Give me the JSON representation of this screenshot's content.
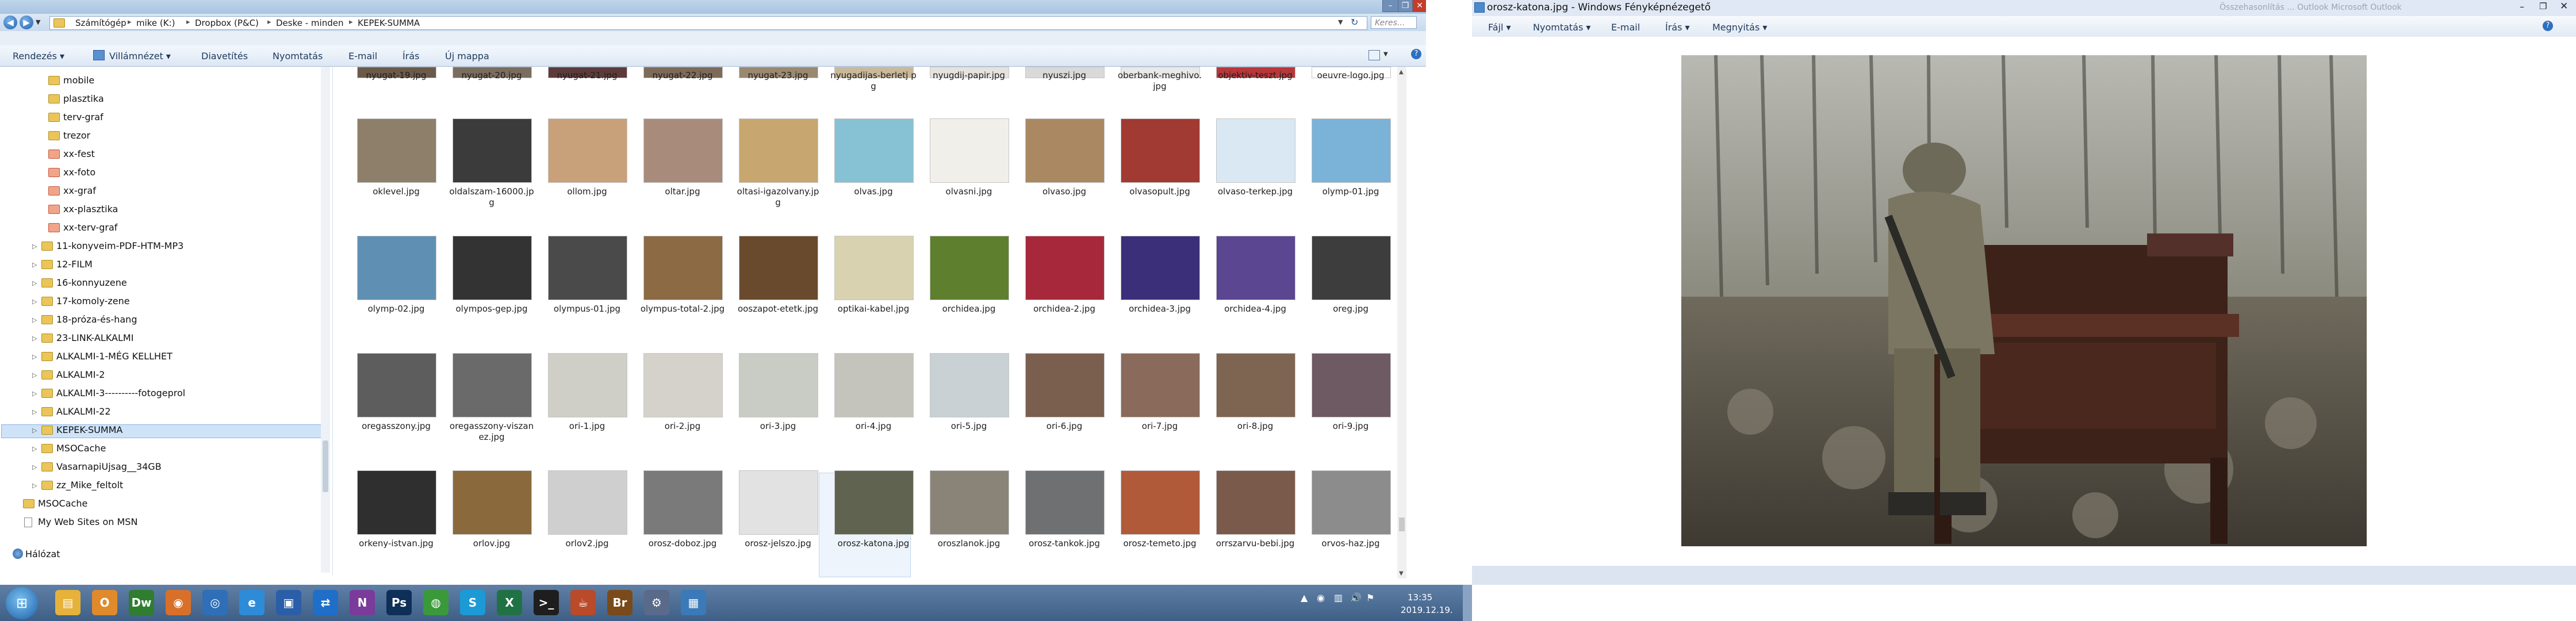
{
  "explorer": {
    "breadcrumb": [
      "Számítógép",
      "mike (K:)",
      "Dropbox (P&C)",
      "Deske - minden",
      "KEPEK-SUMMA"
    ],
    "search_placeholder": "Keres...",
    "commands": [
      "Rendezés ▾",
      "Villámnézet ▾",
      "Diavetítés",
      "Nyomtatás",
      "E-mail",
      "Írás",
      "Új mappa"
    ],
    "sidebar": [
      {
        "label": "mobile",
        "icon": "folder-icon"
      },
      {
        "label": "plasztika",
        "icon": "folder-icon"
      },
      {
        "label": "terv-graf",
        "icon": "folder-icon"
      },
      {
        "label": "trezor",
        "icon": "folder-icon"
      },
      {
        "label": "xx-fest",
        "icon": "folder-red-icon"
      },
      {
        "label": "xx-foto",
        "icon": "folder-red-icon"
      },
      {
        "label": "xx-graf",
        "icon": "folder-red-icon"
      },
      {
        "label": "xx-plasztika",
        "icon": "folder-red-icon"
      },
      {
        "label": "xx-terv-graf",
        "icon": "folder-red-icon"
      },
      {
        "label": "11-konyveim-PDF-HTM-MP3",
        "icon": "folder-icon"
      },
      {
        "label": "12-FILM",
        "icon": "folder-icon"
      },
      {
        "label": "16-konnyuzene",
        "icon": "folder-icon"
      },
      {
        "label": "17-komoly-zene",
        "icon": "folder-icon"
      },
      {
        "label": "18-próza-és-hang",
        "icon": "folder-icon"
      },
      {
        "label": "23-LINK-ALKALMI",
        "icon": "folder-icon"
      },
      {
        "label": "ALKALMI-1-MÉG KELLHET",
        "icon": "folder-icon"
      },
      {
        "label": "ALKALMI-2",
        "icon": "folder-icon"
      },
      {
        "label": "ALKALMI-3----------fotogeprol",
        "icon": "folder-icon"
      },
      {
        "label": "ALKALMI-22",
        "icon": "folder-icon"
      },
      {
        "label": "KEPEK-SUMMA",
        "icon": "folder-icon"
      },
      {
        "label": "MSOCache",
        "icon": "folder-icon"
      },
      {
        "label": "VasarnapiUjsag__34GB",
        "icon": "folder-icon"
      },
      {
        "label": "zz_Mike_feltolt",
        "icon": "folder-icon"
      },
      {
        "label": "MSOCache",
        "icon": "folder-icon"
      },
      {
        "label": "My Web Sites on MSN",
        "icon": "page-icon"
      },
      {
        "label": "Hálózat",
        "icon": "network-icon"
      }
    ],
    "files": [
      {
        "name": "nyugat-19.jpg",
        "color": "#6b5a4a"
      },
      {
        "name": "nyugat-20.jpg",
        "color": "#7a6d5e"
      },
      {
        "name": "nyugat-21.jpg",
        "color": "#5e3b3b"
      },
      {
        "name": "nyugat-22.jpg",
        "color": "#7d6a58"
      },
      {
        "name": "nyugat-23.jpg",
        "color": "#9a8870"
      },
      {
        "name": "nyugadijas-berletj pg",
        "color": "#c9b99a"
      },
      {
        "name": "nyugdij-papir.jpg",
        "color": "#e6e3df"
      },
      {
        "name": "nyuszi.jpg",
        "color": "#d9d9d9"
      },
      {
        "name": "oberbank-meghivo.jpg",
        "color": "#e9e9e9"
      },
      {
        "name": "objektiv-teszt.jpg",
        "color": "#b7373a"
      },
      {
        "name": "oeuvre-logo.jpg",
        "color": "#ffffff"
      },
      {
        "name": "oklevel.jpg",
        "color": "#8e7f6b"
      },
      {
        "name": "oldalszam-16000.jpg",
        "color": "#3b3b3b"
      },
      {
        "name": "ollom.jpg",
        "color": "#c8a07a"
      },
      {
        "name": "oltar.jpg",
        "color": "#a98b7c"
      },
      {
        "name": "oltasi-igazolvany.jpg",
        "color": "#c7a76f"
      },
      {
        "name": "olvas.jpg",
        "color": "#86c2d4"
      },
      {
        "name": "olvasni.jpg",
        "color": "#f0efe9"
      },
      {
        "name": "olvaso.jpg",
        "color": "#a98862"
      },
      {
        "name": "olvasopult.jpg",
        "color": "#a13a32"
      },
      {
        "name": "olvaso-terkep.jpg",
        "color": "#d9e8f2"
      },
      {
        "name": "olymp-01.jpg",
        "color": "#7ab2d8"
      },
      {
        "name": "olymp-02.jpg",
        "color": "#5f8fb3"
      },
      {
        "name": "olympos-gep.jpg",
        "color": "#333333"
      },
      {
        "name": "olympus-01.jpg",
        "color": "#4a4a4a"
      },
      {
        "name": "olympus-total-2.jpg",
        "color": "#8c6a44"
      },
      {
        "name": "ooszapot-etetk.jpg",
        "color": "#6a4a2c"
      },
      {
        "name": "optikai-kabel.jpg",
        "color": "#d8d2b0"
      },
      {
        "name": "orchidea.jpg",
        "color": "#5d7f2e"
      },
      {
        "name": "orchidea-2.jpg",
        "color": "#a7283a"
      },
      {
        "name": "orchidea-3.jpg",
        "color": "#3b2f7a"
      },
      {
        "name": "orchidea-4.jpg",
        "color": "#5a4691"
      },
      {
        "name": "oreg.jpg",
        "color": "#3d3d3d"
      },
      {
        "name": "oregasszony.jpg",
        "color": "#5d5d5d"
      },
      {
        "name": "oregasszony-viszanez.jpg",
        "color": "#6a6a6a"
      },
      {
        "name": "ori-1.jpg",
        "color": "#cfcfc7"
      },
      {
        "name": "ori-2.jpg",
        "color": "#d4d2ca"
      },
      {
        "name": "ori-3.jpg",
        "color": "#c9ccc4"
      },
      {
        "name": "ori-4.jpg",
        "color": "#c4c4bc"
      },
      {
        "name": "ori-5.jpg",
        "color": "#c9d1d5"
      },
      {
        "name": "ori-6.jpg",
        "color": "#7a5f4e"
      },
      {
        "name": "ori-7.jpg",
        "color": "#8a6a5a"
      },
      {
        "name": "ori-8.jpg",
        "color": "#7d6552"
      },
      {
        "name": "ori-9.jpg",
        "color": "#6e5a63"
      },
      {
        "name": "orkeny-istvan.jpg",
        "color": "#2f2f2f"
      },
      {
        "name": "orlov.jpg",
        "color": "#8a6a3c"
      },
      {
        "name": "orlov2.jpg",
        "color": "#cfcfcf"
      },
      {
        "name": "orosz-doboz.jpg",
        "color": "#7a7a7a"
      },
      {
        "name": "orosz-jelszo.jpg",
        "color": "#e2e2e2"
      },
      {
        "name": "orosz-katona.jpg",
        "color": "#5f6350"
      },
      {
        "name": "oroszlanok.jpg",
        "color": "#8a8478"
      },
      {
        "name": "orosz-tankok.jpg",
        "color": "#6e7072"
      },
      {
        "name": "orosz-temeto.jpg",
        "color": "#b05a3a"
      },
      {
        "name": "orrszarvu-bebi.jpg",
        "color": "#7a5a4a"
      },
      {
        "name": "orvos-haz.jpg",
        "color": "#8c8c8c"
      }
    ],
    "selected_file": "orosz-katona.jpg"
  },
  "viewer": {
    "title": "orosz-katona.jpg - Windows Fényképnézegető",
    "menu": [
      "Fájl ▾",
      "Nyomtatás ▾",
      "E-mail",
      "Írás ▾",
      "Megnyitás ▾"
    ],
    "bg_title_text": "Összehasonlítás ... Outlook   Microsoft Outlook"
  },
  "taskbar": {
    "apps": [
      {
        "name": "windows-explorer-icon",
        "glyph": "▤",
        "color": "#e6b23a"
      },
      {
        "name": "outlook-icon",
        "glyph": "O",
        "color": "#e08a2c"
      },
      {
        "name": "dreamweaver-icon",
        "glyph": "Dw",
        "color": "#2f7d2f"
      },
      {
        "name": "firefox-icon",
        "glyph": "◉",
        "color": "#d9702a"
      },
      {
        "name": "chrome-ie-icon",
        "glyph": "◎",
        "color": "#2e6fb8"
      },
      {
        "name": "ie-icon",
        "glyph": "e",
        "color": "#2e8bd8"
      },
      {
        "name": "save-app-icon",
        "glyph": "▣",
        "color": "#2b5ea8"
      },
      {
        "name": "teamviewer-icon",
        "glyph": "⇄",
        "color": "#1f6fc9"
      },
      {
        "name": "onenote-icon",
        "glyph": "N",
        "color": "#7a3b9a"
      },
      {
        "name": "photoshop-icon",
        "glyph": "Ps",
        "color": "#0e2f57"
      },
      {
        "name": "chrome-icon",
        "glyph": "◍",
        "color": "#3a9a3a"
      },
      {
        "name": "skype-icon",
        "glyph": "S",
        "color": "#1c9ad6"
      },
      {
        "name": "excel-icon",
        "glyph": "X",
        "color": "#207245"
      },
      {
        "name": "cmd-icon",
        "glyph": ">_",
        "color": "#1e1e1e"
      },
      {
        "name": "java-icon",
        "glyph": "☕",
        "color": "#b94a2a"
      },
      {
        "name": "bridge-icon",
        "glyph": "Br",
        "color": "#7a4a1a"
      },
      {
        "name": "tool-icon",
        "glyph": "⚙",
        "color": "#5a6a8a"
      },
      {
        "name": "photo-viewer-icon",
        "glyph": "▦",
        "color": "#3a7ab8"
      }
    ],
    "time": "13:35",
    "date": "2019.12.19."
  }
}
